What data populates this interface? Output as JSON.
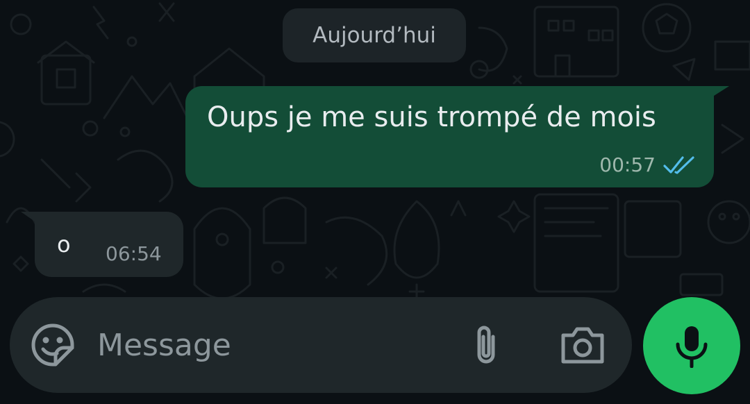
{
  "chat": {
    "date_separator": "Aujourd’hui",
    "messages": [
      {
        "direction": "outgoing",
        "text": "Oups je me suis trompé de mois",
        "time": "00:57",
        "status": "read",
        "status_icon": "double-check-icon",
        "status_color": "#53bdeb"
      },
      {
        "direction": "incoming",
        "text": "o",
        "time": "06:54"
      }
    ]
  },
  "composer": {
    "placeholder": "Message",
    "value": "",
    "emoji_icon": "sticker-emoji-icon",
    "attach_icon": "paperclip-icon",
    "camera_icon": "camera-icon",
    "send_icon": "microphone-icon"
  },
  "colors": {
    "background": "#0b1014",
    "outgoing_bubble": "#134d37",
    "incoming_bubble": "#1f272a",
    "accent": "#21c063",
    "read_ticks": "#53bdeb"
  }
}
